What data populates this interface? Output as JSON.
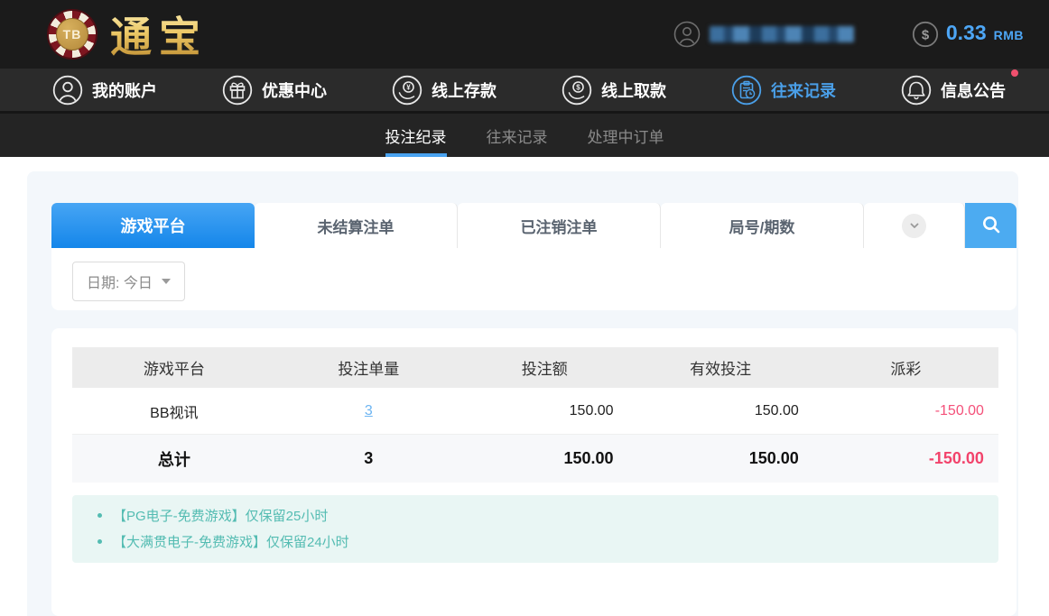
{
  "header": {
    "brand": "通宝",
    "logo_monogram": "TB",
    "balance": {
      "amount": "0.33",
      "currency": "RMB"
    },
    "icons": [
      "user-icon",
      "dollar-coin-icon"
    ]
  },
  "nav": {
    "items": [
      {
        "label": "我的账户",
        "icon": "user-icon",
        "active": false
      },
      {
        "label": "优惠中心",
        "icon": "gift-icon",
        "active": false
      },
      {
        "label": "线上存款",
        "icon": "deposit-hand-coin-icon",
        "active": false
      },
      {
        "label": "线上取款",
        "icon": "withdraw-hand-coin-icon",
        "active": false
      },
      {
        "label": "往来记录",
        "icon": "records-clipboard-icon",
        "active": true
      },
      {
        "label": "信息公告",
        "icon": "bell-icon",
        "active": false,
        "badge": "red-dot"
      }
    ]
  },
  "subnav": {
    "tabs": [
      {
        "label": "投注纪录",
        "active": true
      },
      {
        "label": "往来记录",
        "active": false
      },
      {
        "label": "处理中订单",
        "active": false
      }
    ]
  },
  "filters": {
    "tabs": [
      {
        "label": "游戏平台",
        "active": true
      },
      {
        "label": "未结算注单",
        "active": false
      },
      {
        "label": "已注销注单",
        "active": false
      },
      {
        "label": "局号/期数",
        "active": false
      }
    ],
    "dropdown_icon": "chevron-down-icon",
    "search_icon": "search-icon",
    "date_label": "日期: 今日"
  },
  "table": {
    "columns": [
      "游戏平台",
      "投注单量",
      "投注额",
      "有效投注",
      "派彩"
    ],
    "rows": [
      {
        "cells": [
          "BB视讯",
          "3",
          "150.00",
          "150.00",
          "-150.00"
        ],
        "count_is_link": true,
        "payout_negative": true
      }
    ],
    "total": {
      "cells": [
        "总计",
        "3",
        "150.00",
        "150.00",
        "-150.00"
      ],
      "payout_negative": true
    }
  },
  "notes": [
    "【PG电子-免费游戏】仅保留25小时",
    "【大满贯电子-免费游戏】仅保留24小时"
  ],
  "colors": {
    "accent_blue": "#1f8cec",
    "search_button": "#4cabf1",
    "negative_red": "#f4517a",
    "note_teal": "#54bcb2",
    "badge_red": "#f0506e"
  }
}
